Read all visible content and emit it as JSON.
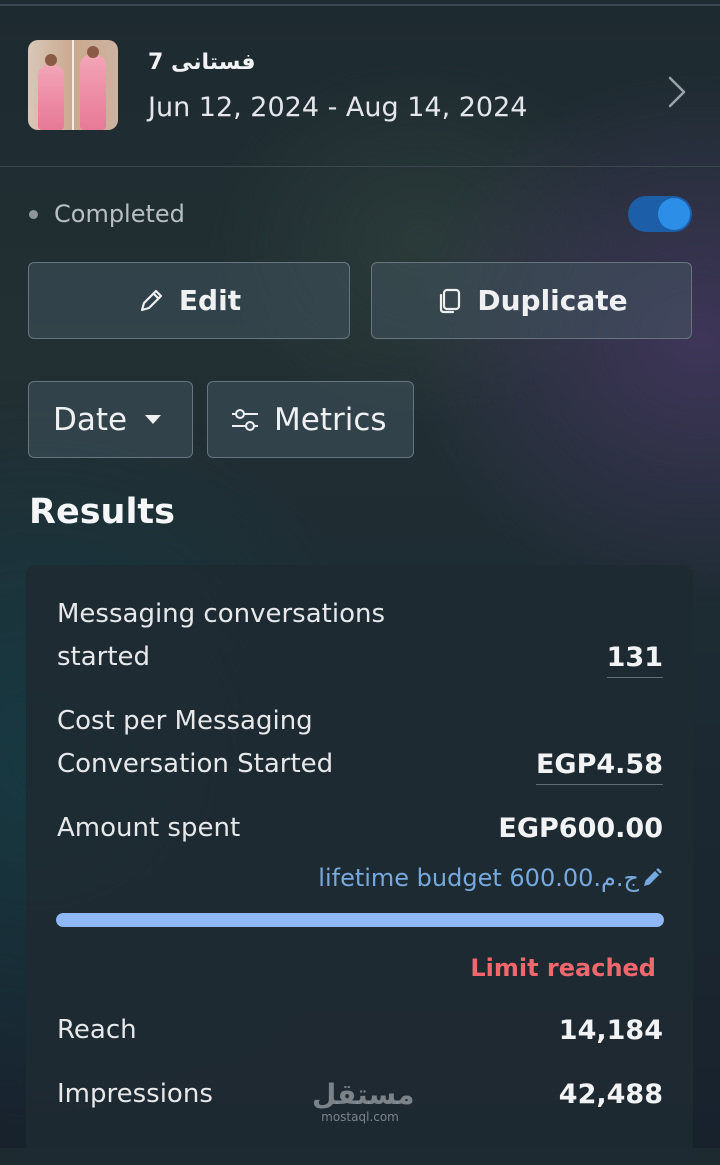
{
  "campaign": {
    "name": "فستانی 7",
    "dates": "Jun 12, 2024 - Aug 14, 2024",
    "thumbnail_icon": "dress-photo-thumbnail"
  },
  "status": {
    "label": "Completed",
    "toggle_on": true,
    "toggle_color": "#2d8ee8"
  },
  "actions": {
    "edit_label": "Edit",
    "duplicate_label": "Duplicate"
  },
  "filters": {
    "date_label": "Date",
    "metrics_label": "Metrics"
  },
  "results": {
    "title": "Results",
    "messaging_label_1": "Messaging conversations",
    "messaging_label_2": "started",
    "messaging_value": "131",
    "cost_label_1": "Cost per Messaging",
    "cost_label_2": "Conversation Started",
    "cost_value": "EGP4.58",
    "amount_label": "Amount spent",
    "amount_value": "EGP600.00",
    "budget_text": "lifetime budget 600.00.ج.م",
    "budget_progress": 1.0,
    "limit_text": "Limit reached",
    "reach_label": "Reach",
    "reach_value": "14,184",
    "impressions_label": "Impressions",
    "impressions_value": "42,488"
  },
  "watermark": {
    "arabic": "مستقل",
    "latin": "mostaql.com"
  },
  "colors": {
    "accent_blue": "#76a9dd",
    "progress": "#8fb7f5",
    "limit_red": "#f0686e"
  }
}
